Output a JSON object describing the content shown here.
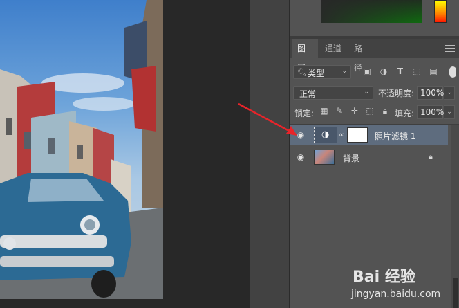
{
  "layers_panel": {
    "tabs": [
      {
        "label": "图层",
        "active": true
      },
      {
        "label": "通道",
        "active": false
      },
      {
        "label": "路径",
        "active": false
      }
    ],
    "filter": {
      "label": "类型"
    },
    "blend_mode": "正常",
    "opacity_label": "不透明度:",
    "opacity_value": "100%",
    "lock_label": "锁定:",
    "fill_label": "填充:",
    "fill_value": "100%",
    "layers": [
      {
        "name": "照片滤镜 1",
        "type": "adjustment",
        "selected": true,
        "visible": true
      },
      {
        "name": "背景",
        "type": "image",
        "selected": false,
        "visible": true,
        "locked": true
      }
    ]
  },
  "colors": {
    "panel_bg": "#535353",
    "selected_layer": "#5e6c7e",
    "annotation_arrow": "#e8242a"
  },
  "icons": {
    "filter_icons": [
      "image-filter-icon",
      "adjustment-filter-icon",
      "text-filter-icon",
      "shape-filter-icon",
      "smart-object-filter-icon"
    ],
    "lock_icons": [
      "lock-transparent-icon",
      "lock-paint-icon",
      "lock-position-icon",
      "lock-artboard-icon",
      "lock-all-icon"
    ]
  },
  "watermark": {
    "logo": "Bai 经验",
    "url": "jingyan.baidu.com"
  }
}
